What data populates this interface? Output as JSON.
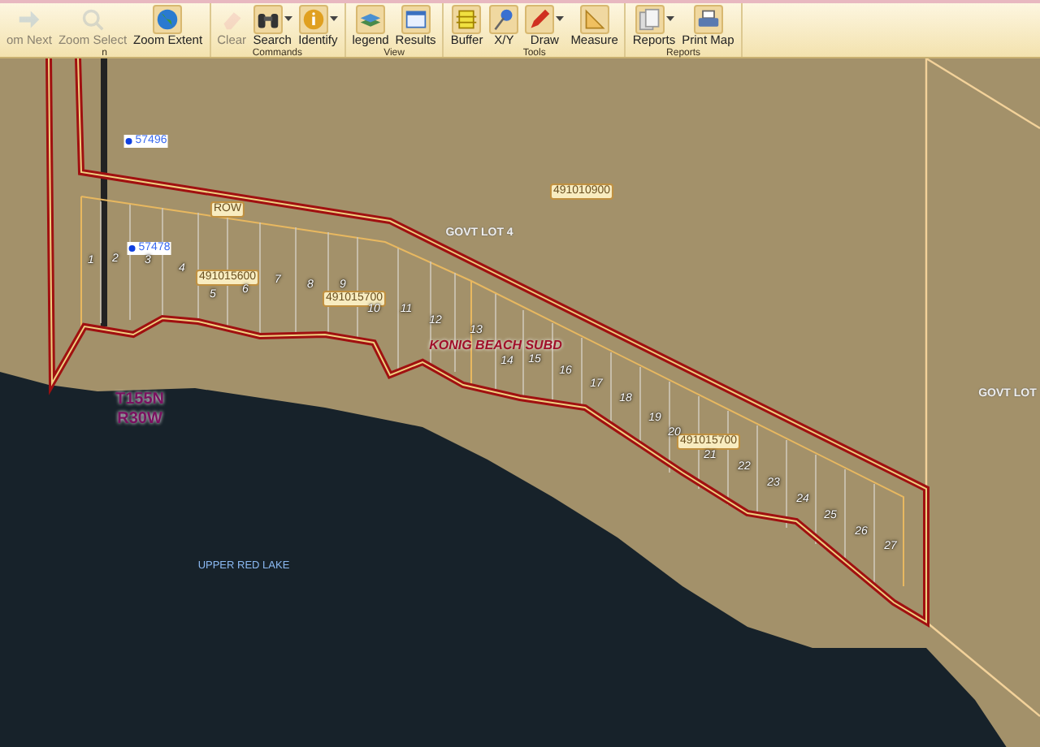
{
  "toolbar": {
    "groups": [
      {
        "label": "n",
        "buttons": [
          {
            "label": "om Next",
            "disabled": true,
            "dropdown": false
          },
          {
            "label": "Zoom Select",
            "disabled": true,
            "dropdown": false
          },
          {
            "label": "Zoom Extent",
            "disabled": false,
            "dropdown": false
          }
        ]
      },
      {
        "label": "Commands",
        "buttons": [
          {
            "label": "Clear",
            "disabled": true,
            "dropdown": false
          },
          {
            "label": "Search",
            "disabled": false,
            "dropdown": true
          },
          {
            "label": "Identify",
            "disabled": false,
            "dropdown": true
          }
        ]
      },
      {
        "label": "View",
        "buttons": [
          {
            "label": "legend",
            "disabled": false,
            "dropdown": false
          },
          {
            "label": "Results",
            "disabled": false,
            "dropdown": false
          }
        ]
      },
      {
        "label": "Tools",
        "buttons": [
          {
            "label": "Buffer",
            "disabled": false,
            "dropdown": false
          },
          {
            "label": "X/Y",
            "disabled": false,
            "dropdown": false
          },
          {
            "label": "Draw",
            "disabled": false,
            "dropdown": true
          },
          {
            "label": "Measure",
            "disabled": false,
            "dropdown": false
          }
        ]
      },
      {
        "label": "Reports",
        "buttons": [
          {
            "label": "Reports",
            "disabled": false,
            "dropdown": true
          },
          {
            "label": "Print Map",
            "disabled": false,
            "dropdown": false
          }
        ]
      }
    ]
  },
  "map": {
    "labels": [
      {
        "text": "57496",
        "kind": "point"
      },
      {
        "text": "57478",
        "kind": "point"
      },
      {
        "text": "ROW",
        "kind": "parcel"
      },
      {
        "text": "491010900",
        "kind": "parcel"
      },
      {
        "text": "GOVT LOT 4",
        "kind": "area"
      },
      {
        "text": "GOVT LOT",
        "kind": "area"
      },
      {
        "text": "491015600",
        "kind": "parcel"
      },
      {
        "text": "491015700",
        "kind": "parcel"
      },
      {
        "text": "491015700",
        "kind": "parcel"
      },
      {
        "text": "KONIG BEACH SUBD",
        "kind": "subdivision"
      },
      {
        "text": "T155N",
        "kind": "township"
      },
      {
        "text": "R30W",
        "kind": "township"
      },
      {
        "text": "UPPER RED LAKE",
        "kind": "water"
      },
      {
        "text": "1",
        "kind": "lot"
      },
      {
        "text": "2",
        "kind": "lot"
      },
      {
        "text": "3",
        "kind": "lot"
      },
      {
        "text": "4",
        "kind": "lot"
      },
      {
        "text": "5",
        "kind": "lot"
      },
      {
        "text": "6",
        "kind": "lot"
      },
      {
        "text": "7",
        "kind": "lot"
      },
      {
        "text": "8",
        "kind": "lot"
      },
      {
        "text": "9",
        "kind": "lot"
      },
      {
        "text": "10",
        "kind": "lot"
      },
      {
        "text": "11",
        "kind": "lot"
      },
      {
        "text": "12",
        "kind": "lot"
      },
      {
        "text": "13",
        "kind": "lot"
      },
      {
        "text": "14",
        "kind": "lot"
      },
      {
        "text": "15",
        "kind": "lot"
      },
      {
        "text": "16",
        "kind": "lot"
      },
      {
        "text": "17",
        "kind": "lot"
      },
      {
        "text": "18",
        "kind": "lot"
      },
      {
        "text": "19",
        "kind": "lot"
      },
      {
        "text": "20",
        "kind": "lot"
      },
      {
        "text": "21",
        "kind": "lot"
      },
      {
        "text": "22",
        "kind": "lot"
      },
      {
        "text": "23",
        "kind": "lot"
      },
      {
        "text": "24",
        "kind": "lot"
      },
      {
        "text": "25",
        "kind": "lot"
      },
      {
        "text": "26",
        "kind": "lot"
      },
      {
        "text": "27",
        "kind": "lot"
      }
    ]
  }
}
